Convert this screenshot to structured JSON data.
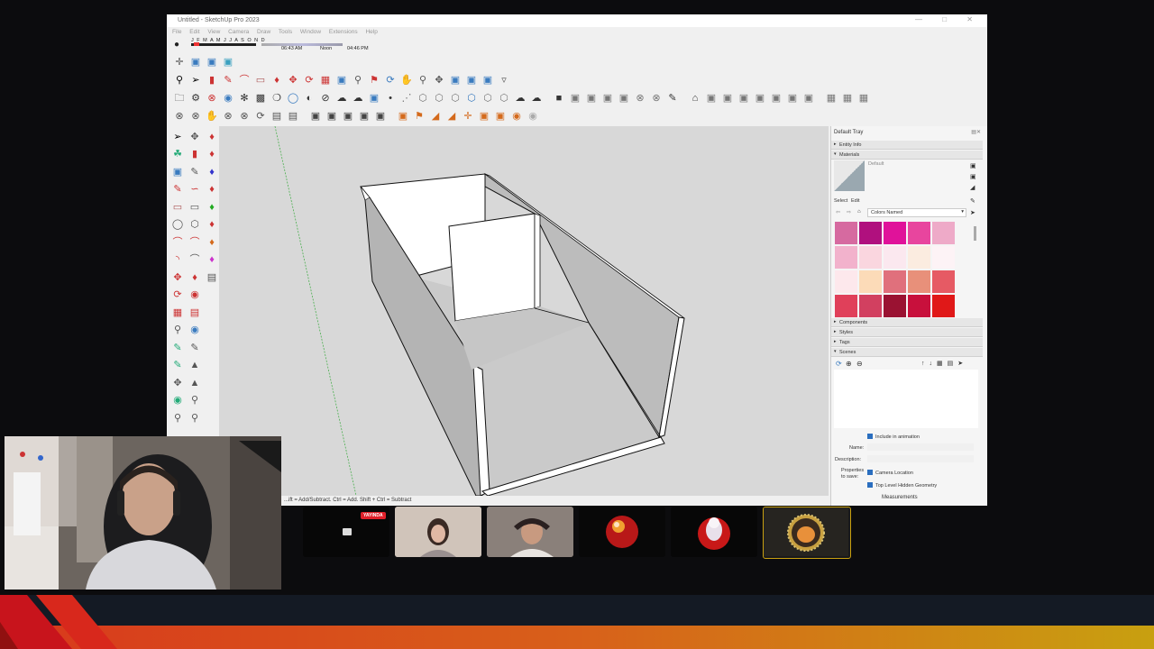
{
  "window": {
    "title": "Untitled - SketchUp Pro 2023",
    "controls": "— □ ✕"
  },
  "menu": [
    "File",
    "Edit",
    "View",
    "Camera",
    "Draw",
    "Tools",
    "Window",
    "Extensions",
    "Help"
  ],
  "shadow_bar": {
    "months": "J F M A M J J A S O N D",
    "time_start": "06:43 AM",
    "noon": "Noon",
    "time_end": "04:46 PM"
  },
  "status_bar": {
    "hint": "...ift = Add/Subtract. Ctrl = Add. Shift + Ctrl = Subtract"
  },
  "tray": {
    "title": "Default Tray",
    "entity_info": "Entity Info",
    "materials": "Materials",
    "material_name": "Default",
    "select_tab": "Select",
    "edit_tab": "Edit",
    "library": "Colors Named",
    "components": "Components",
    "styles": "Styles",
    "tags": "Tags",
    "scenes": "Scenes",
    "include_in_animation": "Include in animation",
    "name_label": "Name:",
    "description_label": "Description:",
    "properties_label": "Properties",
    "to_save_label": "to save:",
    "camera_location": "Camera Location",
    "hidden_geometry": "Top Level Hidden Geometry",
    "measurements": "Measurements"
  },
  "swatches": [
    "#d66aa0",
    "#b0107e",
    "#e0129a",
    "#e8459e",
    "#eeaac8",
    "#f2b2cc",
    "#fad6df",
    "#fbe8ef",
    "#fbece0",
    "#fdf3f6",
    "#fde8ec",
    "#fcdbb8",
    "#e0707c",
    "#e8907a",
    "#e65a64",
    "#e0405a",
    "#d24060",
    "#9a1232",
    "#c8103c",
    "#e01818"
  ],
  "stream": {
    "live_badge": "YAYINDA",
    "accent_orange": "#e8541c",
    "accent_red": "#c8141c",
    "accent_yellow": "#c8a010"
  }
}
